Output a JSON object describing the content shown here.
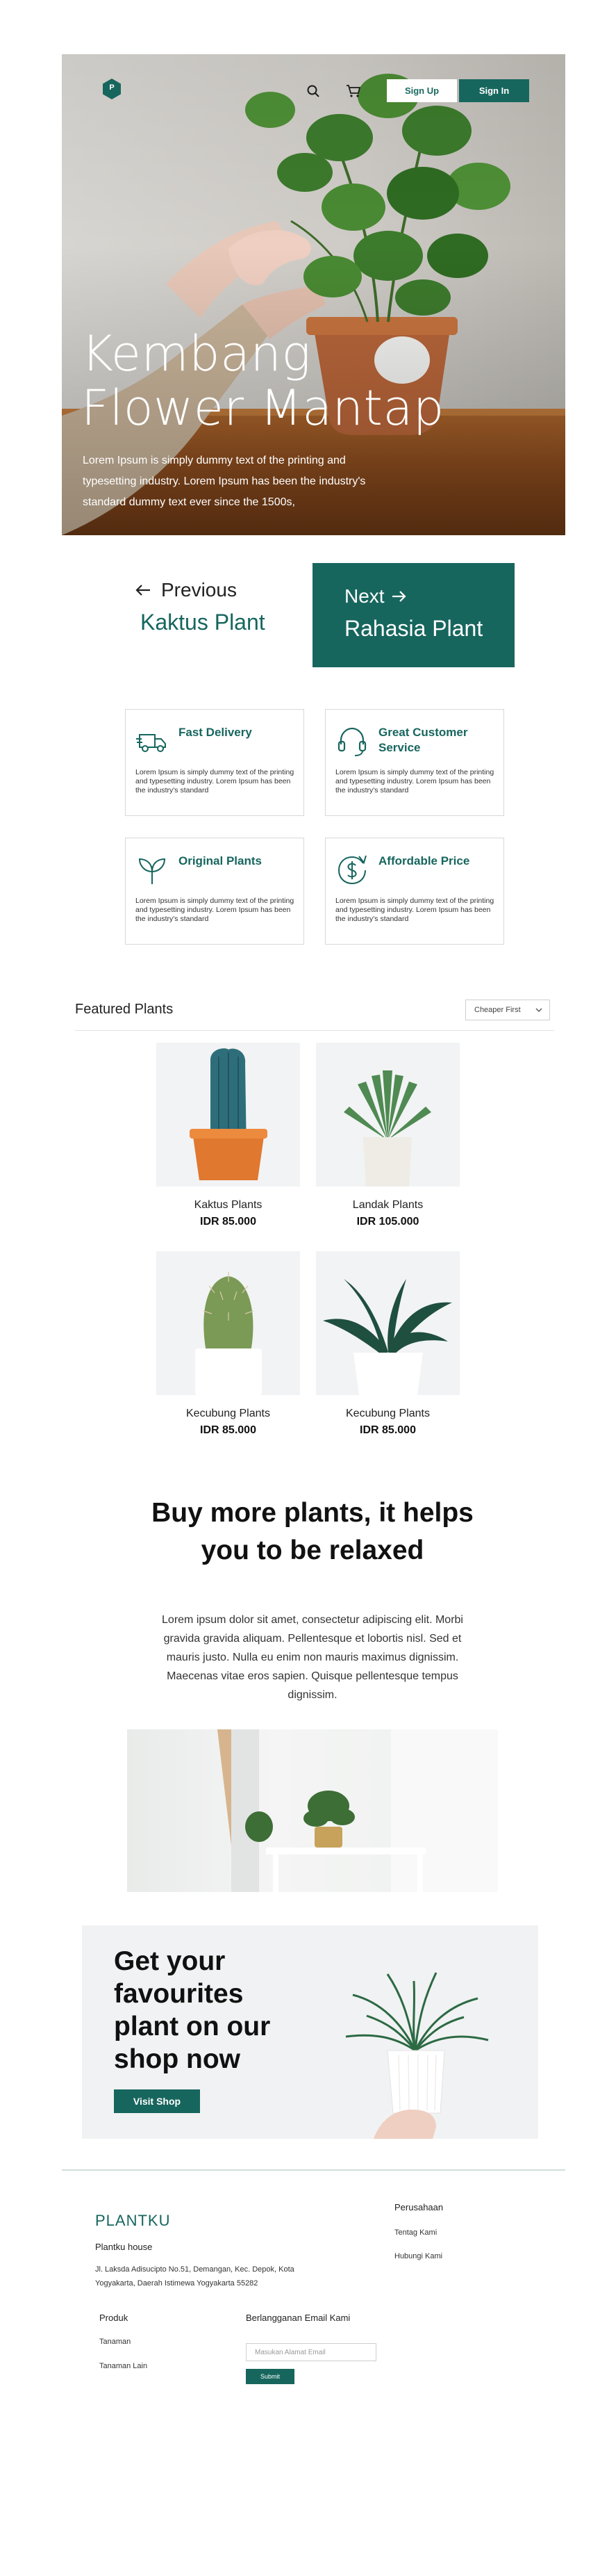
{
  "colors": {
    "brand": "#17665e",
    "white": "#ffffff"
  },
  "header": {
    "logo_letter": "P",
    "signup_label": "Sign Up",
    "signin_label": "Sign In",
    "icons": [
      "search-icon",
      "cart-icon"
    ]
  },
  "hero": {
    "title_line1": "Kembang",
    "title_line2": "Flower Mantap",
    "description": "Lorem Ipsum is simply dummy text of the printing and typesetting industry. Lorem Ipsum has been the industry's standard dummy text ever since the 1500s,"
  },
  "pager": {
    "prev_label": "Previous",
    "prev_name": "Kaktus Plant",
    "next_label": "Next",
    "next_name": "Rahasia Plant"
  },
  "features": [
    {
      "icon": "truck-icon",
      "title": "Fast Delivery",
      "description": "Lorem Ipsum is simply dummy text of the printing and typesetting industry. Lorem Ipsum has been the industry's standard"
    },
    {
      "icon": "headset-icon",
      "title": "Great Customer Service",
      "description": "Lorem Ipsum is simply dummy text of the printing and typesetting industry. Lorem Ipsum has been the industry's standard"
    },
    {
      "icon": "leaf-icon",
      "title": "Original Plants",
      "description": "Lorem Ipsum is simply dummy text of the printing and typesetting industry. Lorem Ipsum has been the industry's standard"
    },
    {
      "icon": "dollar-icon",
      "title": "Affordable Price",
      "description": "Lorem Ipsum is simply dummy text of the printing and typesetting industry. Lorem Ipsum has been the industry's standard"
    }
  ],
  "featured": {
    "title": "Featured Plants",
    "sort_value": "Cheaper First",
    "products": [
      {
        "name": "Kaktus Plants",
        "price": "IDR 85.000"
      },
      {
        "name": "Landak Plants",
        "price": "IDR 105.000"
      },
      {
        "name": "Kecubung Plants",
        "price": "IDR 85.000"
      },
      {
        "name": "Kecubung Plants",
        "price": "IDR 85.000"
      }
    ]
  },
  "relax": {
    "title": "Buy more plants, it helps you to be relaxed",
    "description": "Lorem ipsum dolor sit amet, consectetur adipiscing elit. Morbi gravida gravida aliquam. Pellentesque et lobortis nisl. Sed et mauris justo. Nulla eu enim non mauris maximus dignissim. Maecenas vitae eros sapien. Quisque pellentesque tempus dignissim."
  },
  "cta": {
    "title": "Get your favourites plant on our shop now",
    "button_label": "Visit Shop"
  },
  "footer": {
    "brand": "PLANTKU",
    "house": "Plantku house",
    "address": "Jl. Laksda Adisucipto No.51, Demangan, Kec. Depok, Kota Yogyakarta, Daerah Istimewa Yogyakarta 55282",
    "company_heading": "Perusahaan",
    "company_links": [
      "Tentag Kami",
      "Hubungi Kami"
    ],
    "product_heading": "Produk",
    "product_links": [
      "Tanaman",
      "Tanaman Lain"
    ],
    "subscribe_heading": "Berlangganan Email Kami",
    "email_placeholder": "Masukan Alamat Email",
    "submit_label": "Submit"
  }
}
